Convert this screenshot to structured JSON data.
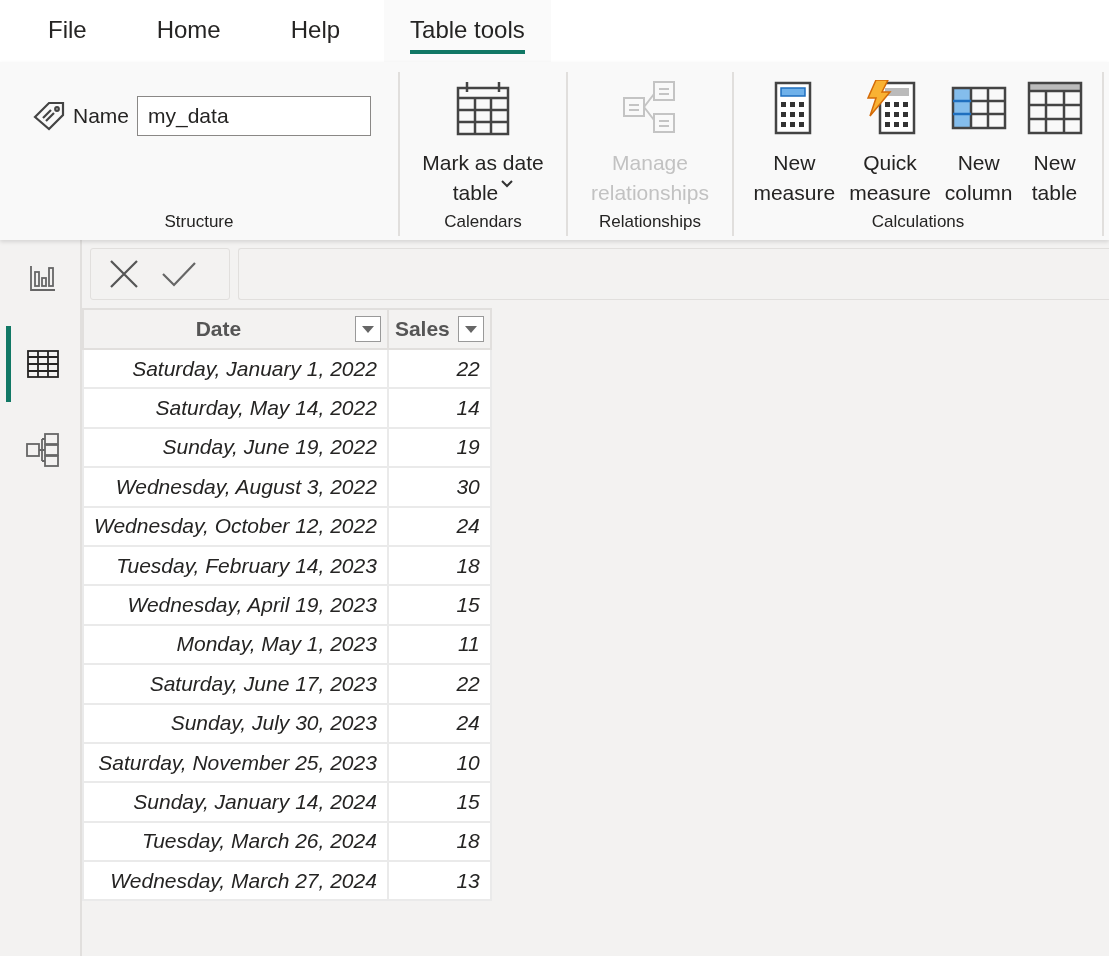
{
  "tabs": [
    {
      "label": "File",
      "selected": false
    },
    {
      "label": "Home",
      "selected": false
    },
    {
      "label": "Help",
      "selected": false
    },
    {
      "label": "Table tools",
      "selected": true
    }
  ],
  "ribbon": {
    "name_field": {
      "label": "Name",
      "value": "my_data"
    },
    "groups": [
      {
        "label": "Structure",
        "kind": "name"
      },
      {
        "label": "Calendars",
        "kind": "buttons",
        "buttons": [
          {
            "label": "Mark as date\ntable",
            "dropdown": true,
            "disabled": false
          }
        ]
      },
      {
        "label": "Relationships",
        "kind": "buttons",
        "buttons": [
          {
            "label": "Manage\nrelationships",
            "dropdown": false,
            "disabled": true
          }
        ]
      },
      {
        "label": "Calculations",
        "kind": "buttons",
        "buttons": [
          {
            "label": "New\nmeasure",
            "dropdown": false,
            "disabled": false
          },
          {
            "label": "Quick\nmeasure",
            "dropdown": false,
            "disabled": false
          },
          {
            "label": "New\ncolumn",
            "dropdown": false,
            "disabled": false
          },
          {
            "label": "New\ntable",
            "dropdown": false,
            "disabled": false
          }
        ]
      }
    ]
  },
  "views": [
    {
      "selected": false
    },
    {
      "selected": true
    },
    {
      "selected": false
    }
  ],
  "table": {
    "columns": [
      "Date",
      "Sales"
    ],
    "rows": [
      [
        "Saturday, January 1, 2022",
        "22"
      ],
      [
        "Saturday, May 14, 2022",
        "14"
      ],
      [
        "Sunday, June 19, 2022",
        "19"
      ],
      [
        "Wednesday, August 3, 2022",
        "30"
      ],
      [
        "Wednesday, October 12, 2022",
        "24"
      ],
      [
        "Tuesday, February 14, 2023",
        "18"
      ],
      [
        "Wednesday, April 19, 2023",
        "15"
      ],
      [
        "Monday, May 1, 2023",
        "11"
      ],
      [
        "Saturday, June 17, 2023",
        "22"
      ],
      [
        "Sunday, July 30, 2023",
        "24"
      ],
      [
        "Saturday, November 25, 2023",
        "10"
      ],
      [
        "Sunday, January 14, 2024",
        "15"
      ],
      [
        "Tuesday, March 26, 2024",
        "18"
      ],
      [
        "Wednesday, March 27, 2024",
        "13"
      ]
    ]
  }
}
